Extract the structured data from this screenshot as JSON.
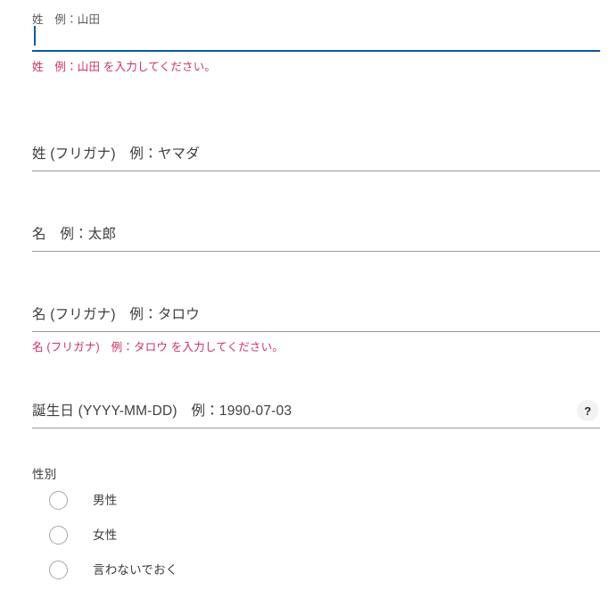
{
  "colors": {
    "focus_accent": "#0b5a9e",
    "error_text": "#cf3360",
    "underline_rest": "#9b9b9b",
    "text_primary": "#3c3c3c",
    "help_icon_bg": "#f2f2f2"
  },
  "fields": [
    {
      "key": "last_name",
      "label": "姓　例：山田",
      "value": "",
      "state": "focused",
      "error": "姓　例：山田 を入力してください。"
    },
    {
      "key": "last_name_kana",
      "label": "姓 (フリガナ)　例：ヤマダ",
      "value": "",
      "state": "rest",
      "error": ""
    },
    {
      "key": "first_name",
      "label": "名　例：太郎",
      "value": "",
      "state": "rest",
      "error": ""
    },
    {
      "key": "first_name_kana",
      "label": "名 (フリガナ)　例：タロウ",
      "value": "",
      "state": "rest",
      "error": "名 (フリガナ)　例：タロウ を入力してください。"
    },
    {
      "key": "birthday",
      "label": "誕生日 (YYYY-MM-DD)　例：1990-07-03",
      "value": "",
      "state": "rest",
      "error": "",
      "help_icon": "question-mark-icon",
      "help_glyph": "?"
    }
  ],
  "gender": {
    "label": "性別",
    "options": [
      {
        "key": "male",
        "label": "男性",
        "selected": false
      },
      {
        "key": "female",
        "label": "女性",
        "selected": false
      },
      {
        "key": "undisclosed",
        "label": "言わないでおく",
        "selected": false
      }
    ]
  }
}
